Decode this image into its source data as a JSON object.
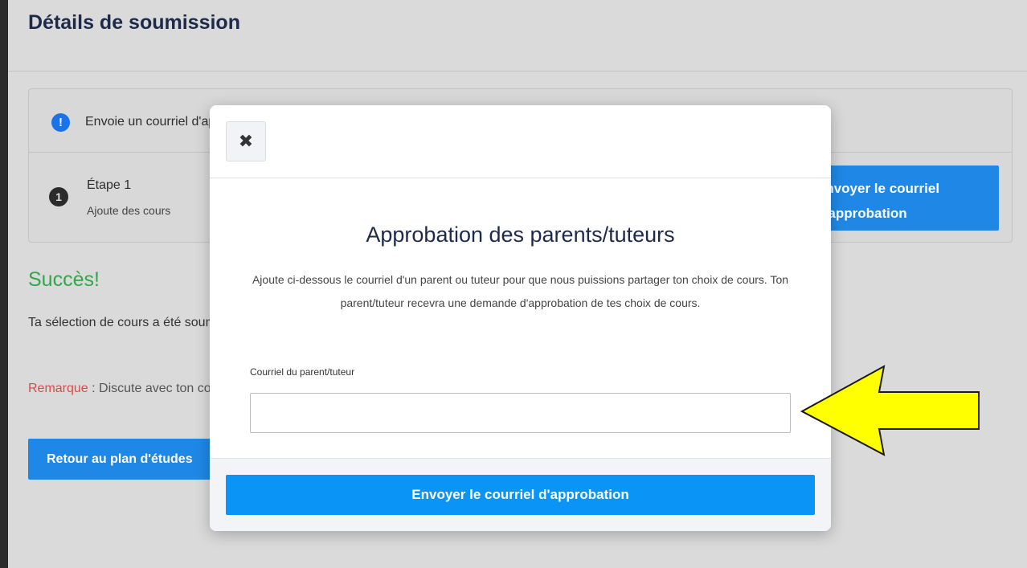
{
  "page": {
    "title": "Détails de soumission",
    "alert_text": "Envoie un courriel d'approbation à un parent ou tuteur.",
    "alert_icon": "exclamation-icon",
    "step": {
      "number": "1",
      "title": "Étape 1",
      "subtitle": "Ajoute des cours"
    },
    "card_button_label": "Envoyer le courriel d'approbation",
    "success_title": "Succès!",
    "paragraph1": "Ta sélection de cours a été soumise. N'oublie pas d'imprimer ta feuille à signer ou d'envoyer un courriel d'approbation.",
    "remark_label": "Remarque",
    "remark_text": " : Discute avec ton conseiller ou ta conseillère si tu as des changements à apporter à ta sélection de cours",
    "back_button_label": "Retour au plan d'études"
  },
  "modal": {
    "close_icon": "close-icon",
    "close_glyph": "✖",
    "title": "Approbation des parents/tuteurs",
    "description": "Ajoute ci-dessous le courriel d'un parent ou tuteur pour que nous puissions partager ton choix de cours. Ton parent/tuteur recevra une demande d'approbation de tes choix de cours.",
    "email_label": "Courriel du parent/tuteur",
    "email_value": "",
    "submit_label": "Envoyer le courriel d'approbation"
  },
  "colors": {
    "primary_button": "#0a94f6",
    "success": "#2ea84a",
    "remark": "#e04848",
    "annotation_arrow": "#ffff00"
  }
}
